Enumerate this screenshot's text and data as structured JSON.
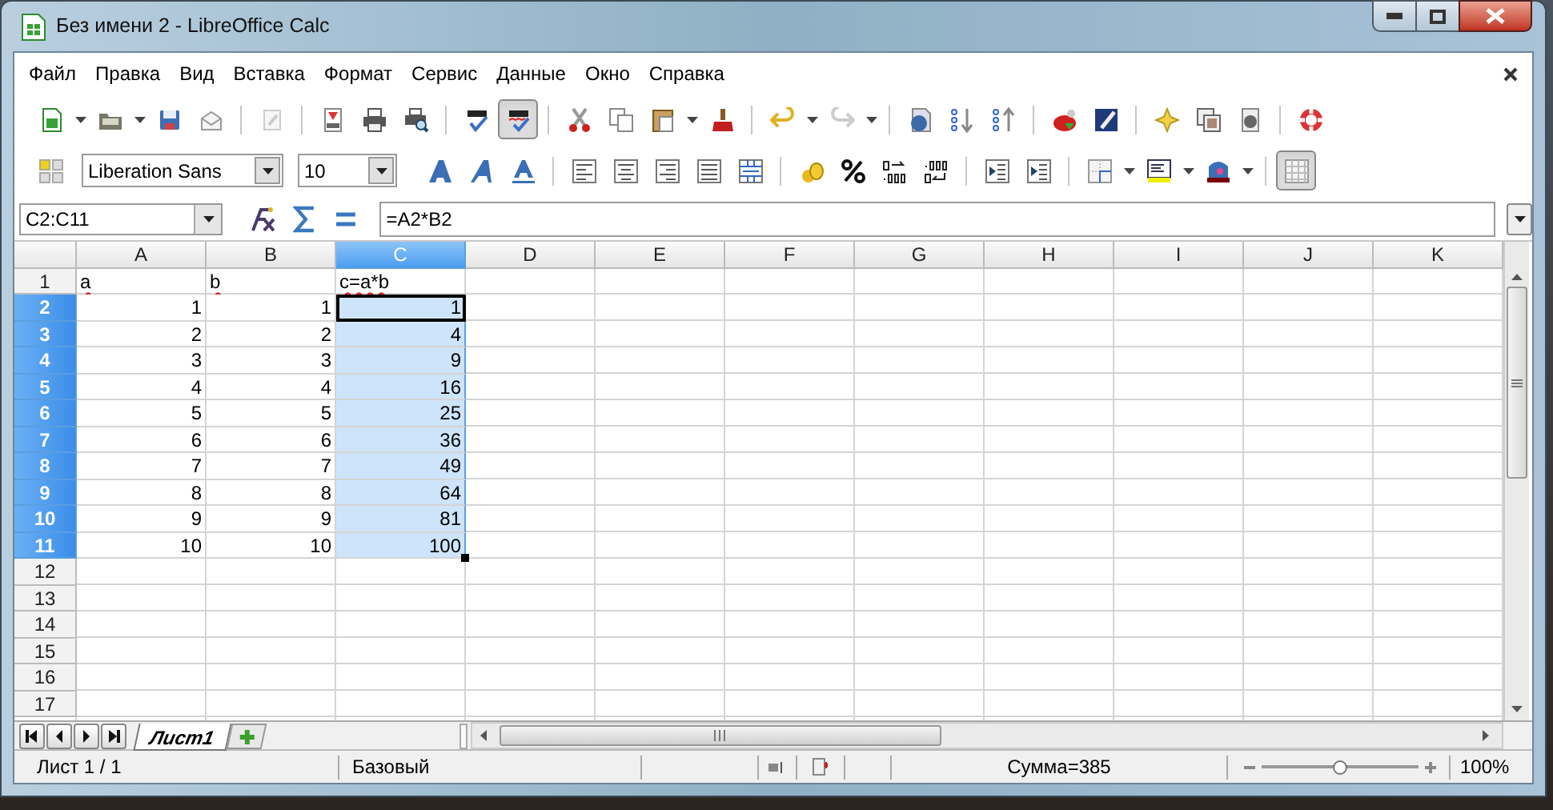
{
  "window": {
    "title": "Без имени 2 - LibreOffice Calc"
  },
  "menu": [
    "Файл",
    "Правка",
    "Вид",
    "Вставка",
    "Формат",
    "Сервис",
    "Данные",
    "Окно",
    "Справка"
  ],
  "toolbar": {
    "autospellcheck_on": true
  },
  "formatting": {
    "font_name": "Liberation Sans",
    "font_size": "10",
    "grid_on": true
  },
  "formula_bar": {
    "name_box": "C2:C11",
    "formula": "=A2*B2"
  },
  "columns": [
    {
      "label": "A",
      "selected": false
    },
    {
      "label": "B",
      "selected": false
    },
    {
      "label": "C",
      "selected": true
    },
    {
      "label": "D",
      "selected": false
    },
    {
      "label": "E",
      "selected": false
    },
    {
      "label": "F",
      "selected": false
    },
    {
      "label": "G",
      "selected": false
    },
    {
      "label": "H",
      "selected": false
    },
    {
      "label": "I",
      "selected": false
    },
    {
      "label": "J",
      "selected": false
    },
    {
      "label": "K",
      "selected": false
    }
  ],
  "rows": [
    {
      "label": "1",
      "selected": false,
      "cells": [
        {
          "text": "a",
          "kind": "text",
          "spell_error": true,
          "active": false
        },
        {
          "text": "b",
          "kind": "text",
          "spell_error": true,
          "active": false
        },
        {
          "text": "c=a*b",
          "kind": "text",
          "spell_error": true,
          "active": false
        }
      ]
    },
    {
      "label": "2",
      "selected": true,
      "cells": [
        {
          "text": "1",
          "kind": "number",
          "spell_error": false,
          "active": false
        },
        {
          "text": "1",
          "kind": "number",
          "spell_error": false,
          "active": false
        },
        {
          "text": "1",
          "kind": "number",
          "spell_error": false,
          "active": true
        }
      ]
    },
    {
      "label": "3",
      "selected": true,
      "cells": [
        {
          "text": "2",
          "kind": "number",
          "spell_error": false,
          "active": false
        },
        {
          "text": "2",
          "kind": "number",
          "spell_error": false,
          "active": false
        },
        {
          "text": "4",
          "kind": "number",
          "spell_error": false,
          "active": false
        }
      ]
    },
    {
      "label": "4",
      "selected": true,
      "cells": [
        {
          "text": "3",
          "kind": "number",
          "spell_error": false,
          "active": false
        },
        {
          "text": "3",
          "kind": "number",
          "spell_error": false,
          "active": false
        },
        {
          "text": "9",
          "kind": "number",
          "spell_error": false,
          "active": false
        }
      ]
    },
    {
      "label": "5",
      "selected": true,
      "cells": [
        {
          "text": "4",
          "kind": "number",
          "spell_error": false,
          "active": false
        },
        {
          "text": "4",
          "kind": "number",
          "spell_error": false,
          "active": false
        },
        {
          "text": "16",
          "kind": "number",
          "spell_error": false,
          "active": false
        }
      ]
    },
    {
      "label": "6",
      "selected": true,
      "cells": [
        {
          "text": "5",
          "kind": "number",
          "spell_error": false,
          "active": false
        },
        {
          "text": "5",
          "kind": "number",
          "spell_error": false,
          "active": false
        },
        {
          "text": "25",
          "kind": "number",
          "spell_error": false,
          "active": false
        }
      ]
    },
    {
      "label": "7",
      "selected": true,
      "cells": [
        {
          "text": "6",
          "kind": "number",
          "spell_error": false,
          "active": false
        },
        {
          "text": "6",
          "kind": "number",
          "spell_error": false,
          "active": false
        },
        {
          "text": "36",
          "kind": "number",
          "spell_error": false,
          "active": false
        }
      ]
    },
    {
      "label": "8",
      "selected": true,
      "cells": [
        {
          "text": "7",
          "kind": "number",
          "spell_error": false,
          "active": false
        },
        {
          "text": "7",
          "kind": "number",
          "spell_error": false,
          "active": false
        },
        {
          "text": "49",
          "kind": "number",
          "spell_error": false,
          "active": false
        }
      ]
    },
    {
      "label": "9",
      "selected": true,
      "cells": [
        {
          "text": "8",
          "kind": "number",
          "spell_error": false,
          "active": false
        },
        {
          "text": "8",
          "kind": "number",
          "spell_error": false,
          "active": false
        },
        {
          "text": "64",
          "kind": "number",
          "spell_error": false,
          "active": false
        }
      ]
    },
    {
      "label": "10",
      "selected": true,
      "cells": [
        {
          "text": "9",
          "kind": "number",
          "spell_error": false,
          "active": false
        },
        {
          "text": "9",
          "kind": "number",
          "spell_error": false,
          "active": false
        },
        {
          "text": "81",
          "kind": "number",
          "spell_error": false,
          "active": false
        }
      ]
    },
    {
      "label": "11",
      "selected": true,
      "cells": [
        {
          "text": "10",
          "kind": "number",
          "spell_error": false,
          "active": false
        },
        {
          "text": "10",
          "kind": "number",
          "spell_error": false,
          "active": false
        },
        {
          "text": "100",
          "kind": "number",
          "spell_error": false,
          "active": false
        }
      ]
    },
    {
      "label": "12",
      "selected": false,
      "cells": []
    },
    {
      "label": "13",
      "selected": false,
      "cells": []
    },
    {
      "label": "14",
      "selected": false,
      "cells": []
    },
    {
      "label": "15",
      "selected": false,
      "cells": []
    },
    {
      "label": "16",
      "selected": false,
      "cells": []
    },
    {
      "label": "17",
      "selected": false,
      "cells": []
    }
  ],
  "sheet_tabs": [
    {
      "label": "Лист1",
      "selected": true
    }
  ],
  "status_bar": {
    "sheet": "Лист 1 / 1",
    "page_style": "Базовый",
    "sum": "Сумма=385",
    "zoom": {
      "level": 0.5
    },
    "zoom_percent": "100%"
  }
}
